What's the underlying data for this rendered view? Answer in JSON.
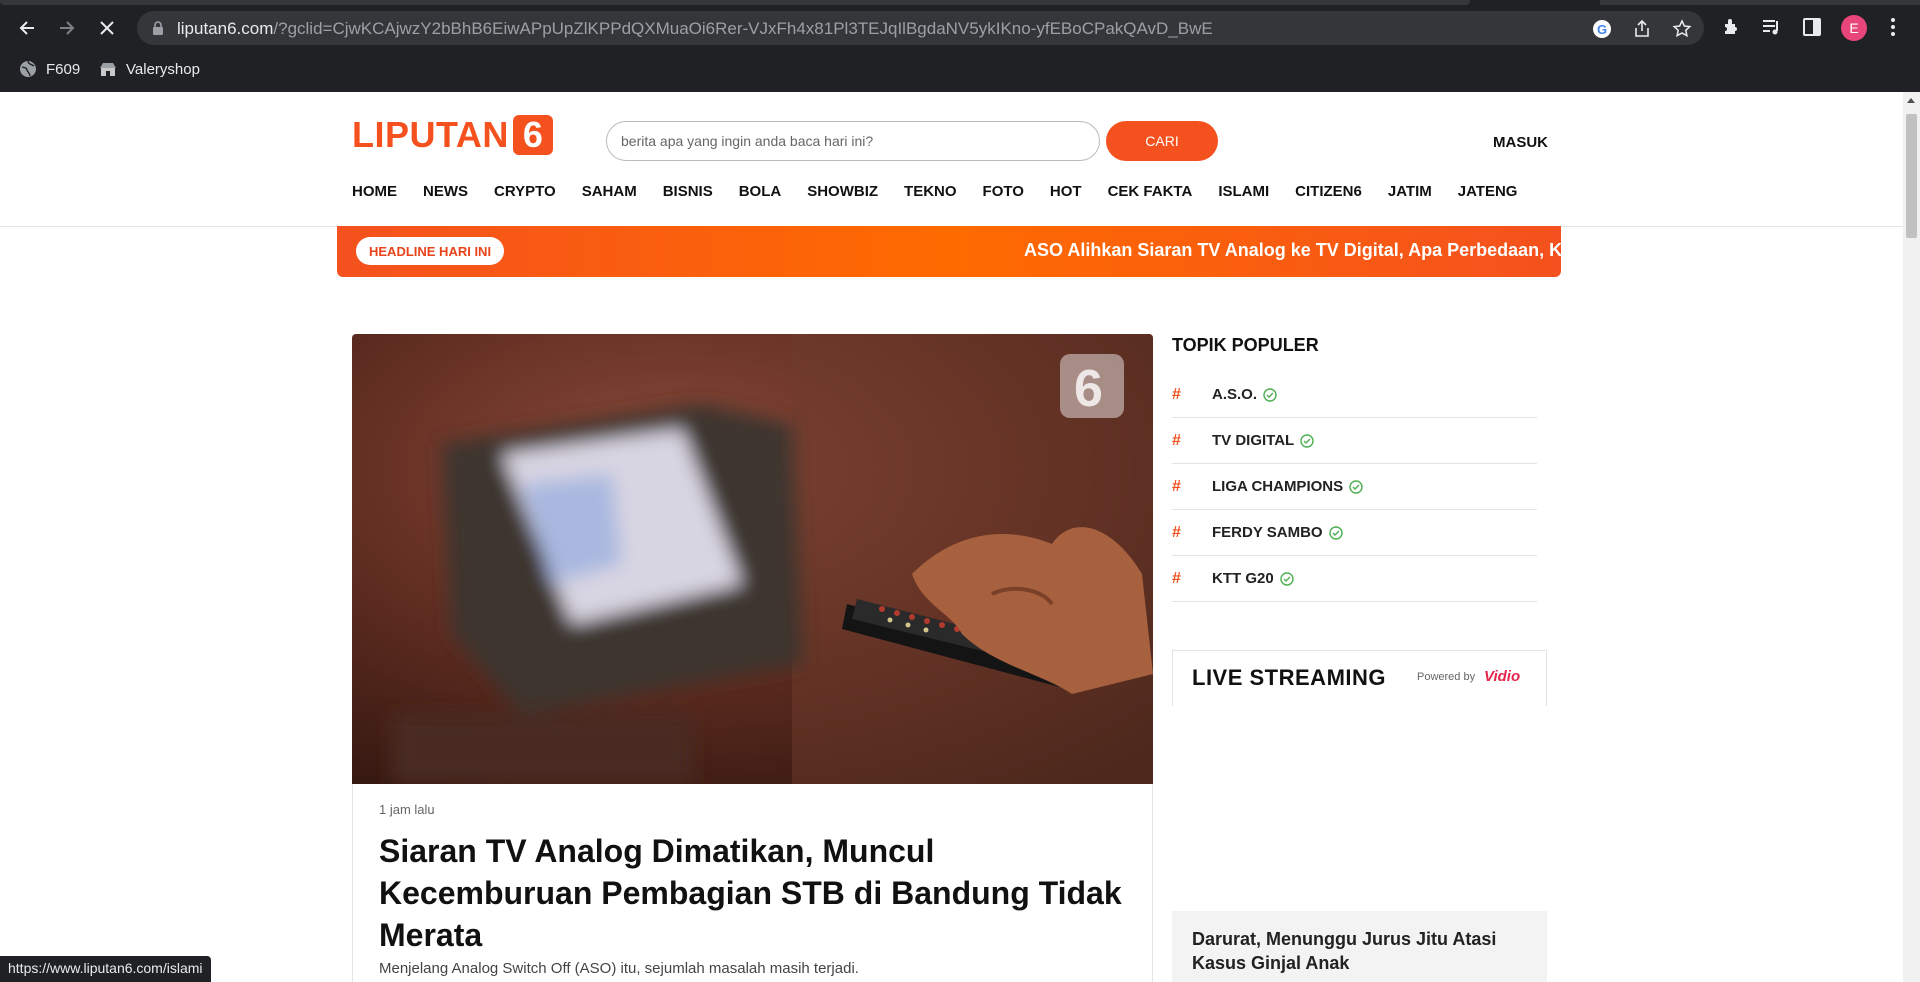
{
  "browser": {
    "url_host": "liputan6.com",
    "url_path": "/?gclid=CjwKCAjwzY2bBhB6EiwAPpUpZlKPPdQXMuaOi6Rer-VJxFh4x81Pl3TEJqIlBgdaNV5ykIKno-yfEBoCPakQAvD_BwE",
    "profile_initial": "E",
    "bookmarks": [
      "F609",
      "Valeryshop"
    ],
    "status_url": "https://www.liputan6.com/islami"
  },
  "header": {
    "logo_word": "LIPUTAN",
    "logo_number": "6",
    "search_placeholder": "berita apa yang ingin anda baca hari ini?",
    "search_button": "CARI",
    "login": "MASUK"
  },
  "nav": [
    "HOME",
    "NEWS",
    "CRYPTO",
    "SAHAM",
    "BISNIS",
    "BOLA",
    "SHOWBIZ",
    "TEKNO",
    "FOTO",
    "HOT",
    "CEK FAKTA",
    "ISLAMI",
    "CITIZEN6",
    "JATIM",
    "JATENG"
  ],
  "headline": {
    "badge": "HEADLINE HARI INI",
    "ticker": "ASO Alihkan Siaran TV Analog ke TV Digital, Apa Perbedaan, Keun"
  },
  "hero": {
    "time": "1 jam lalu",
    "title": "Siaran TV Analog Dimatikan, Muncul Kecemburuan Pembagian STB di Bandung Tidak Merata",
    "summary": "Menjelang Analog Switch Off (ASO) itu, sejumlah masalah masih terjadi."
  },
  "sidebar": {
    "topik_title": "TOPIK POPULER",
    "topik": [
      {
        "hash": "#",
        "label": "A.S.O."
      },
      {
        "hash": "#",
        "label": "TV DIGITAL"
      },
      {
        "hash": "#",
        "label": "LIGA CHAMPIONS"
      },
      {
        "hash": "#",
        "label": "FERDY SAMBO"
      },
      {
        "hash": "#",
        "label": "KTT G20"
      }
    ],
    "live_title": "LIVE STREAMING",
    "powered_by": "Powered by",
    "powered_brand": "Vidio",
    "card_title": "Darurat, Menunggu Jurus Jitu Atasi Kasus Ginjal Anak"
  },
  "colors": {
    "brand": "#f4511e",
    "chrome": "#202124",
    "check": "#4caf50"
  }
}
